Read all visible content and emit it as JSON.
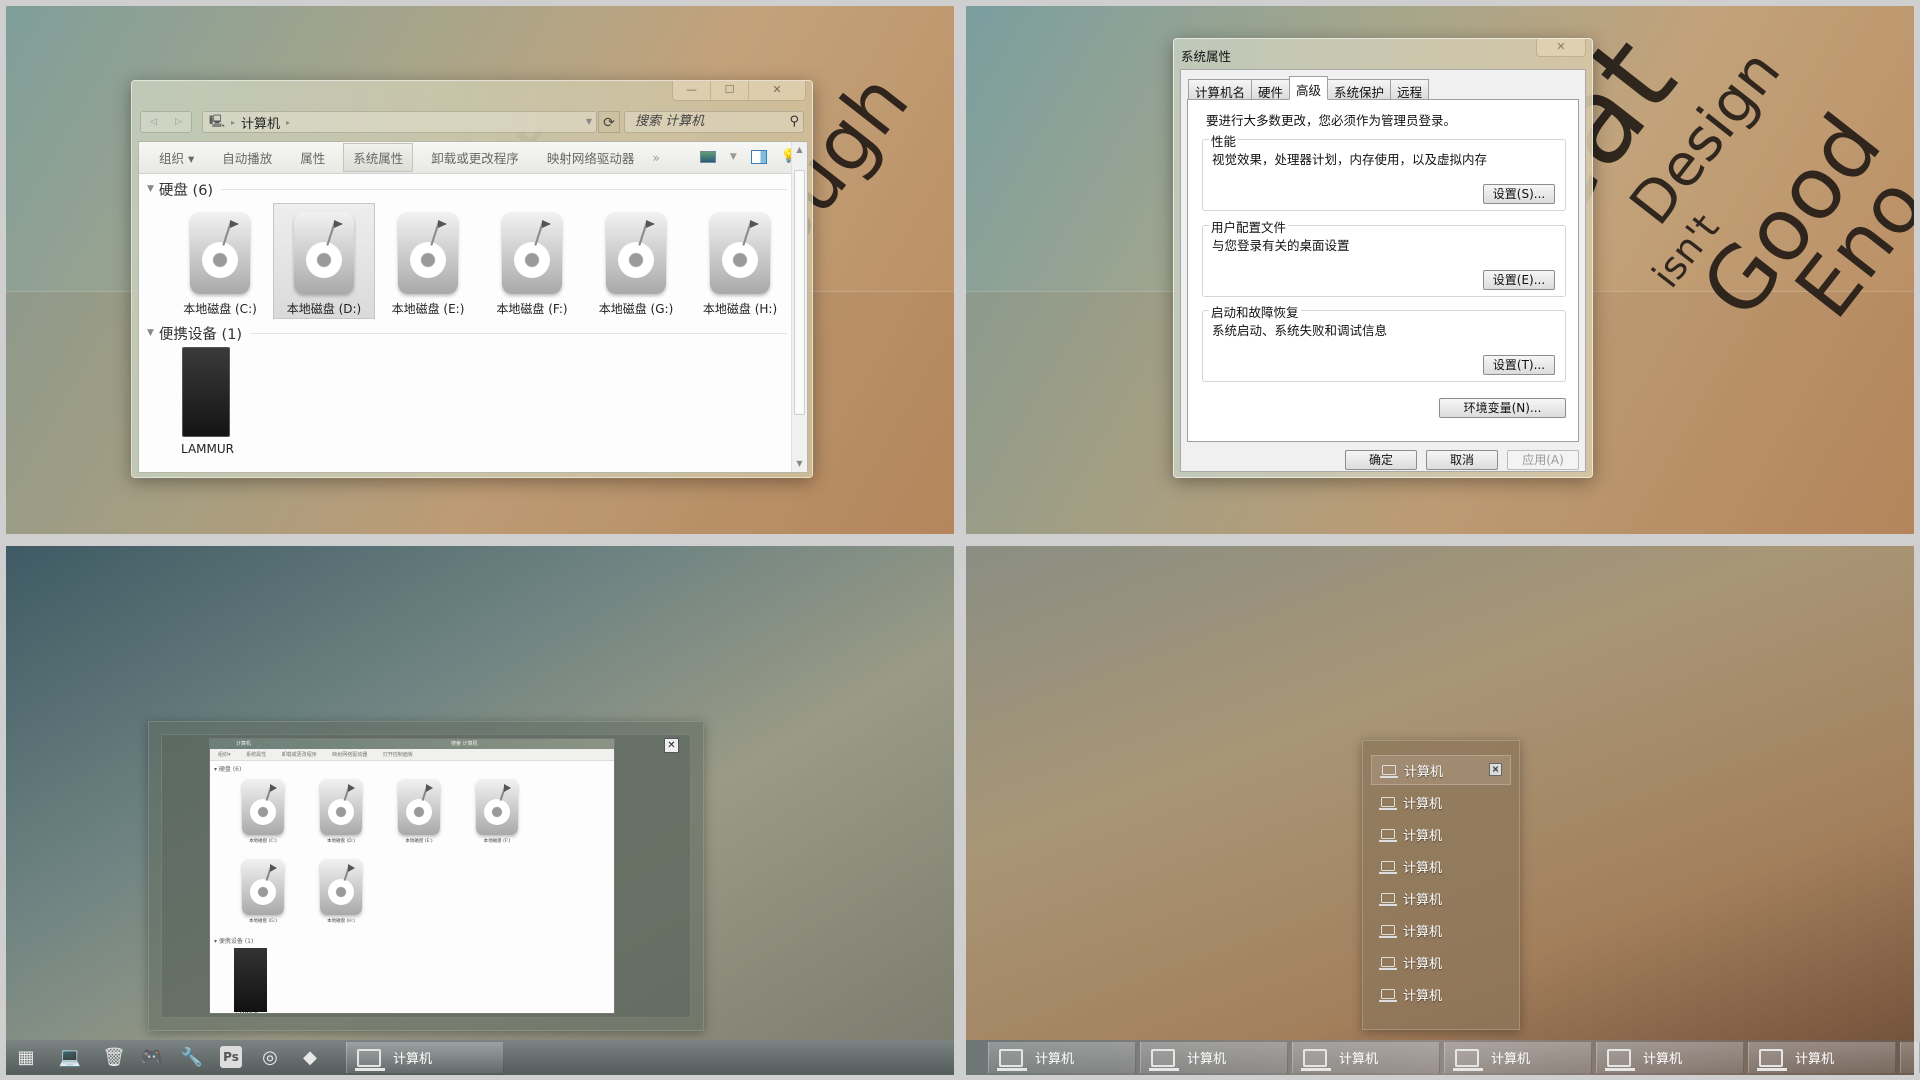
{
  "explorer": {
    "window_controls": {
      "minimize": "—",
      "maximize": "☐",
      "close": "✕"
    },
    "nav": {
      "back": "◁",
      "forward": "▷"
    },
    "address": {
      "root_icon": "computer-icon",
      "path": "计算机"
    },
    "search": {
      "placeholder": "搜索 计算机"
    },
    "toolbar": {
      "items": [
        "组织 ▾",
        "自动播放",
        "属性",
        "系统属性",
        "卸载或更改程序",
        "映射网络驱动器"
      ],
      "active": "系统属性",
      "more": "»"
    },
    "groups": {
      "hard_disks": {
        "title": "硬盘 (6)"
      },
      "portable": {
        "title": "便携设备 (1)"
      }
    },
    "drives": [
      {
        "label": "本地磁盘 (C:)",
        "selected": false
      },
      {
        "label": "本地磁盘 (D:)",
        "selected": true
      },
      {
        "label": "本地磁盘 (E:)",
        "selected": false
      },
      {
        "label": "本地磁盘 (F:)",
        "selected": false
      },
      {
        "label": "本地磁盘 (G:)",
        "selected": false
      },
      {
        "label": "本地磁盘 (H:)",
        "selected": false
      }
    ],
    "devices": [
      {
        "label": "LAMMUR"
      }
    ]
  },
  "wallpaper": {
    "q1_text": "ough",
    "q2_words": [
      "eat",
      "Design",
      "isn't",
      "Good",
      "Eno"
    ]
  },
  "system_properties": {
    "title": "系统属性",
    "close": "✕",
    "tabs": [
      "计算机名",
      "硬件",
      "高级",
      "系统保护",
      "远程"
    ],
    "active_tab": "高级",
    "note": "要进行大多数更改，您必须作为管理员登录。",
    "groups": [
      {
        "title": "性能",
        "desc": "视觉效果，处理器计划，内存使用，以及虚拟内存",
        "button": "设置(S)..."
      },
      {
        "title": "用户配置文件",
        "desc": "与您登录有关的桌面设置",
        "button": "设置(E)..."
      },
      {
        "title": "启动和故障恢复",
        "desc": "系统启动、系统失败和调试信息",
        "button": "设置(T)..."
      }
    ],
    "env_button": "环境变量(N)...",
    "ok": "确定",
    "cancel": "取消",
    "apply": "应用(A)"
  },
  "thumbnail": {
    "close": "✕",
    "address": "计算机",
    "search": "搜索 计算机",
    "toolbar": "组织▾ 系统属性 卸载或更改程序 映射网络驱动器 打开控制面板",
    "group1": "▾ 硬盘 (6)",
    "group2": "▾ 便携设备 (1)",
    "drives": [
      "本地磁盘 (C:)",
      "本地磁盘 (D:)",
      "本地磁盘 (E:)",
      "本地磁盘 (F:)",
      "本地磁盘 (G:)",
      "本地磁盘 (H:)"
    ],
    "device": "LAMMUR"
  },
  "jumplist": {
    "items": [
      "计算机",
      "计算机",
      "计算机",
      "计算机",
      "计算机",
      "计算机",
      "计算机",
      "计算机"
    ],
    "close": "✕"
  },
  "taskbar_left": {
    "pinned": [
      {
        "name": "start-icon",
        "glyph": "▦"
      },
      {
        "name": "computer-icon",
        "glyph": "💻"
      },
      {
        "name": "recycle-bin-icon",
        "glyph": "🗑"
      },
      {
        "name": "gamepad-icon",
        "glyph": "🎮"
      },
      {
        "name": "wrench-icon",
        "glyph": "🔧"
      },
      {
        "name": "photoshop-icon",
        "glyph": "Ps"
      },
      {
        "name": "chrome-icon",
        "glyph": "◎"
      },
      {
        "name": "firefox-icon",
        "glyph": "◆"
      }
    ],
    "window_button": "计算机"
  },
  "taskbar_right": {
    "window_buttons": [
      "计算机",
      "计算机",
      "计算机",
      "计算机",
      "计算机",
      "计算机"
    ]
  }
}
